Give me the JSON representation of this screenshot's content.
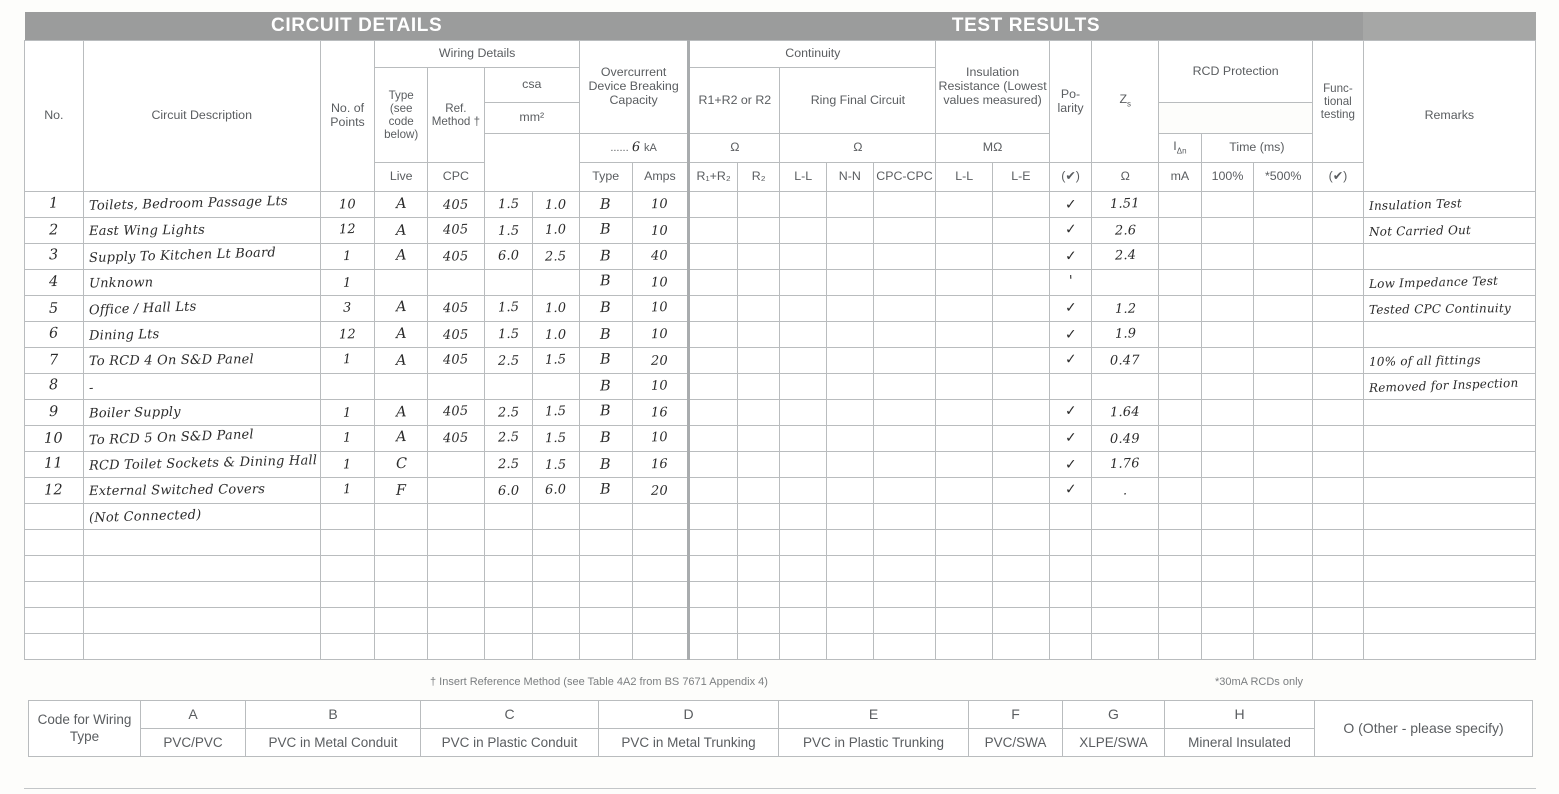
{
  "banner": {
    "circuit_details": "CIRCUIT DETAILS",
    "test_results": "TEST RESULTS"
  },
  "headers": {
    "no": "No.",
    "circuit_description": "Circuit Description",
    "no_of_points": "No. of Points",
    "wiring_details": "Wiring Details",
    "type_see_code": "Type (see code below)",
    "ref_method": "Ref. Method †",
    "csa": "csa",
    "mm2": "mm²",
    "live": "Live",
    "cpc": "CPC",
    "overcurrent": "Overcurrent Device Breaking Capacity",
    "ka_value": "6",
    "ka_unit": "kA",
    "ocd_type": "Type",
    "ocd_amps": "Amps",
    "continuity": "Continuity",
    "r1r2_or_r2": "R1+R2 or R2",
    "ring_final": "Ring Final Circuit",
    "ohm": "Ω",
    "r1_plus_r2": "R₁+R₂",
    "r2": "R₂",
    "ll": "L-L",
    "nn": "N-N",
    "cpc_cpc": "CPC-CPC",
    "insulation": "Insulation Resistance (Lowest values measured)",
    "megohm": "MΩ",
    "ins_ll": "L-L",
    "ins_le": "L-E",
    "polarity": "Po-larity",
    "polarity_unit": "(✔)",
    "zs": "Z",
    "zs_sub": "s",
    "zs_unit": "Ω",
    "rcd_protection": "RCD Protection",
    "idn": "I",
    "idn_sub": "Δn",
    "ma": "mA",
    "time_ms": "Time (ms)",
    "pct100": "100%",
    "pct500": "*500%",
    "functional": "Func-tional testing",
    "functional_unit": "(✔)",
    "remarks": "Remarks"
  },
  "footnotes": {
    "ref_method": "† Insert Reference Method (see Table 4A2 from BS 7671 Appendix 4)",
    "rcd_note": "*30mA RCDs only"
  },
  "rows": [
    {
      "no": "1",
      "desc": "Toilets, Bedroom Passage Lts",
      "points": "10",
      "type": "A",
      "ref": "405",
      "live": "1.5",
      "cpc": "1.0",
      "ocd_type": "B",
      "amps": "10",
      "polarity": "✓",
      "zs": "1.51",
      "remarks": "Insulation Test"
    },
    {
      "no": "2",
      "desc": "East Wing Lights",
      "points": "12",
      "type": "A",
      "ref": "405",
      "live": "1.5",
      "cpc": "1.0",
      "ocd_type": "B",
      "amps": "10",
      "polarity": "✓",
      "zs": "2.6",
      "remarks": "Not Carried Out"
    },
    {
      "no": "3",
      "desc": "Supply To Kitchen Lt Board",
      "points": "1",
      "type": "A",
      "ref": "405",
      "live": "6.0",
      "cpc": "2.5",
      "ocd_type": "B",
      "amps": "40",
      "polarity": "✓",
      "zs": "2.4",
      "remarks": ""
    },
    {
      "no": "4",
      "desc": "Unknown",
      "points": "1",
      "type": "",
      "ref": "",
      "live": "",
      "cpc": "",
      "ocd_type": "B",
      "amps": "10",
      "polarity": "'",
      "zs": "",
      "remarks": "Low Impedance Test"
    },
    {
      "no": "5",
      "desc": "Office / Hall Lts",
      "points": "3",
      "type": "A",
      "ref": "405",
      "live": "1.5",
      "cpc": "1.0",
      "ocd_type": "B",
      "amps": "10",
      "polarity": "✓",
      "zs": "1.2",
      "remarks": "Tested CPC Continuity"
    },
    {
      "no": "6",
      "desc": "Dining Lts",
      "points": "12",
      "type": "A",
      "ref": "405",
      "live": "1.5",
      "cpc": "1.0",
      "ocd_type": "B",
      "amps": "10",
      "polarity": "✓",
      "zs": "1.9",
      "remarks": ""
    },
    {
      "no": "7",
      "desc": "To RCD 4 On S&D Panel",
      "points": "1",
      "type": "A",
      "ref": "405",
      "live": "2.5",
      "cpc": "1.5",
      "ocd_type": "B",
      "amps": "20",
      "polarity": "✓",
      "zs": "0.47",
      "remarks": "10% of all fittings"
    },
    {
      "no": "8",
      "desc": "-",
      "points": "",
      "type": "",
      "ref": "",
      "live": "",
      "cpc": "",
      "ocd_type": "B",
      "amps": "10",
      "polarity": "",
      "zs": "",
      "remarks": "Removed for Inspection"
    },
    {
      "no": "9",
      "desc": "Boiler Supply",
      "points": "1",
      "type": "A",
      "ref": "405",
      "live": "2.5",
      "cpc": "1.5",
      "ocd_type": "B",
      "amps": "16",
      "polarity": "✓",
      "zs": "1.64",
      "remarks": ""
    },
    {
      "no": "10",
      "desc": "To RCD 5 On S&D Panel",
      "points": "1",
      "type": "A",
      "ref": "405",
      "live": "2.5",
      "cpc": "1.5",
      "ocd_type": "B",
      "amps": "10",
      "polarity": "✓",
      "zs": "0.49",
      "remarks": ""
    },
    {
      "no": "11",
      "desc": "RCD Toilet Sockets & Dining Hall",
      "points": "1",
      "type": "C",
      "ref": "",
      "live": "2.5",
      "cpc": "1.5",
      "ocd_type": "B",
      "amps": "16",
      "polarity": "✓",
      "zs": "1.76",
      "remarks": ""
    },
    {
      "no": "12",
      "desc": "External Switched Covers",
      "points": "1",
      "type": "F",
      "ref": "",
      "live": "6.0",
      "cpc": "6.0",
      "ocd_type": "B",
      "amps": "20",
      "polarity": "✓",
      "zs": ".",
      "remarks": ""
    },
    {
      "no": "",
      "desc": "(Not Connected)",
      "points": "",
      "type": "",
      "ref": "",
      "live": "",
      "cpc": "",
      "ocd_type": "",
      "amps": "",
      "polarity": "",
      "zs": "",
      "remarks": ""
    },
    {
      "no": "",
      "desc": "",
      "points": "",
      "type": "",
      "ref": "",
      "live": "",
      "cpc": "",
      "ocd_type": "",
      "amps": "",
      "polarity": "",
      "zs": "",
      "remarks": ""
    },
    {
      "no": "",
      "desc": "",
      "points": "",
      "type": "",
      "ref": "",
      "live": "",
      "cpc": "",
      "ocd_type": "",
      "amps": "",
      "polarity": "",
      "zs": "",
      "remarks": ""
    },
    {
      "no": "",
      "desc": "",
      "points": "",
      "type": "",
      "ref": "",
      "live": "",
      "cpc": "",
      "ocd_type": "",
      "amps": "",
      "polarity": "",
      "zs": "",
      "remarks": ""
    },
    {
      "no": "",
      "desc": "",
      "points": "",
      "type": "",
      "ref": "",
      "live": "",
      "cpc": "",
      "ocd_type": "",
      "amps": "",
      "polarity": "",
      "zs": "",
      "remarks": ""
    },
    {
      "no": "",
      "desc": "",
      "points": "",
      "type": "",
      "ref": "",
      "live": "",
      "cpc": "",
      "ocd_type": "",
      "amps": "",
      "polarity": "",
      "zs": "",
      "remarks": ""
    }
  ],
  "code_table": {
    "label": "Code for Wiring Type",
    "entries": [
      {
        "letter": "A",
        "text": "PVC/PVC"
      },
      {
        "letter": "B",
        "text": "PVC in Metal Conduit"
      },
      {
        "letter": "C",
        "text": "PVC in Plastic Conduit"
      },
      {
        "letter": "D",
        "text": "PVC in Metal Trunking"
      },
      {
        "letter": "E",
        "text": "PVC in Plastic Trunking"
      },
      {
        "letter": "F",
        "text": "PVC/SWA"
      },
      {
        "letter": "G",
        "text": "XLPE/SWA"
      },
      {
        "letter": "H",
        "text": "Mineral Insulated"
      },
      {
        "letter": "O (Other - please specify)",
        "text": ""
      }
    ]
  },
  "colors": {
    "banner_bg": "#9b9c9c",
    "grid_line": "#b9bcbe",
    "ink": "#2b2b2b",
    "print_text": "#5a5d60"
  }
}
